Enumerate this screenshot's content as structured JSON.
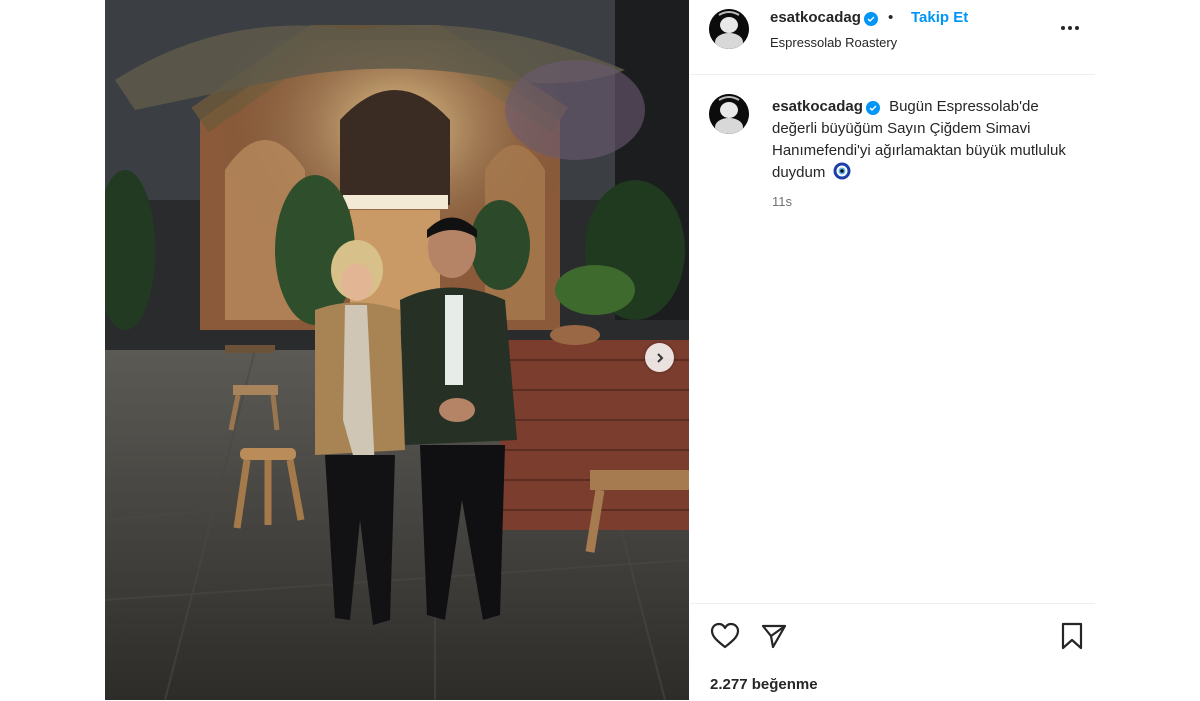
{
  "post": {
    "username": "esatkocadag",
    "separator": "•",
    "follow_label": "Takip Et",
    "location": "Espressolab Roastery",
    "caption": "Bugün Espressolab'de değerli büyüğüm Sayın Çiğdem Simavi Hanımefendi'yi ağırlamaktan büyük mutluluk duydum",
    "caption_emoji": "nazar-boncuk-icon",
    "time_ago": "11s",
    "likes": "2.277 beğenme"
  },
  "colors": {
    "accent": "#0095f6",
    "text": "#262626",
    "muted": "#737373"
  },
  "icons": [
    "verified-badge-icon",
    "more-options-icon",
    "like-heart-icon",
    "share-send-icon",
    "save-bookmark-icon",
    "next-arrow-icon"
  ]
}
